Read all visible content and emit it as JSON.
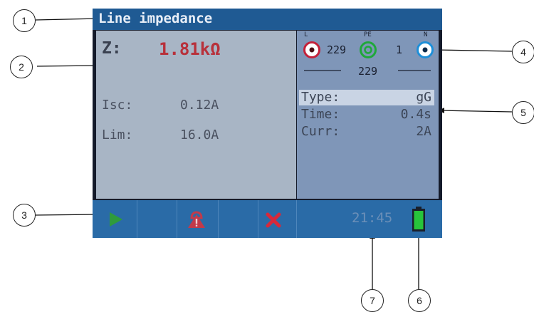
{
  "screen": {
    "title": "Line impedance",
    "z_label": "Z:",
    "z_value": "1.81kΩ",
    "isc_label": "Isc:",
    "isc_value": "0.12A",
    "lim_label": "Lim:",
    "lim_value": "16.0A",
    "terminals": {
      "l_label": "L",
      "pe_label": "PE",
      "n_label": "N",
      "l_pe_voltage": "229",
      "pe_n_voltage": "1",
      "l_n_voltage": "229"
    },
    "params": {
      "type_label": "Type:",
      "type_value": "gG",
      "time_label": "Time:",
      "time_value": "0.4s",
      "curr_label": "Curr:",
      "curr_value": "2A"
    },
    "clock": "21:45",
    "battery_icon": "battery-full-icon"
  },
  "callouts": [
    "1",
    "2",
    "3",
    "4",
    "5",
    "6",
    "7"
  ],
  "colors": {
    "title_bar": "#1f5a93",
    "toolbar": "#2a6ba7",
    "z_value": "#b8303a",
    "start": "#2f9b3c",
    "lock": "#c23a4a",
    "cancel": "#d8283a",
    "battery": "#27c43b"
  }
}
